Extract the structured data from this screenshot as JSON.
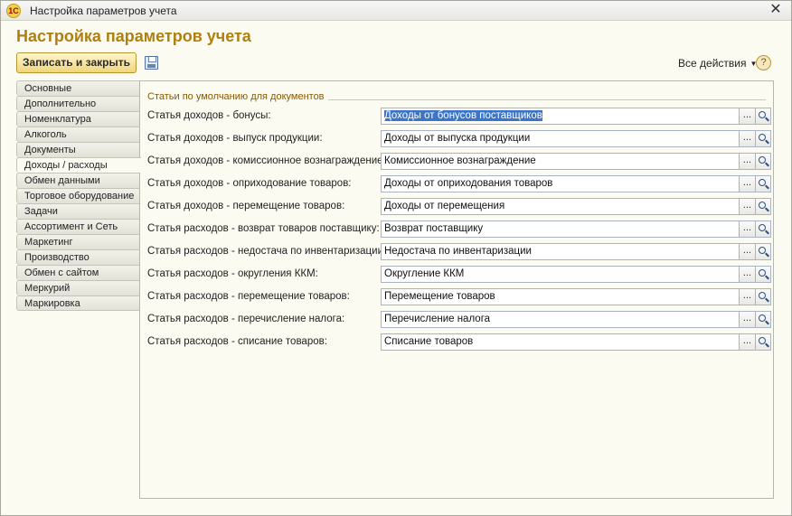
{
  "window": {
    "title": "Настройка параметров учета",
    "close_glyph": "✕",
    "app_icon_text": "1С"
  },
  "header": {
    "page_title": "Настройка параметров учета"
  },
  "toolbar": {
    "save_close_label": "Записать и закрыть",
    "all_actions_label": "Все действия",
    "help_glyph": "?"
  },
  "tabs": [
    {
      "label": "Основные",
      "active": false
    },
    {
      "label": "Дополнительно",
      "active": false
    },
    {
      "label": "Номенклатура",
      "active": false
    },
    {
      "label": "Алкоголь",
      "active": false
    },
    {
      "label": "Документы",
      "active": false
    },
    {
      "label": "Доходы / расходы",
      "active": true
    },
    {
      "label": "Обмен данными",
      "active": false
    },
    {
      "label": "Торговое оборудование",
      "active": false
    },
    {
      "label": "Задачи",
      "active": false
    },
    {
      "label": "Ассортимент и Сеть",
      "active": false
    },
    {
      "label": "Маркетинг",
      "active": false
    },
    {
      "label": "Производство",
      "active": false
    },
    {
      "label": "Обмен с сайтом",
      "active": false
    },
    {
      "label": "Меркурий",
      "active": false
    },
    {
      "label": "Маркировка",
      "active": false
    }
  ],
  "group": {
    "title": "Статьи по умолчанию для документов",
    "rows": [
      {
        "label": "Статья доходов - бонусы:",
        "value": "Доходы от бонусов поставщиков",
        "selected": true
      },
      {
        "label": "Статья доходов - выпуск продукции:",
        "value": "Доходы от выпуска продукции",
        "selected": false
      },
      {
        "label": "Статья доходов - комиссионное вознаграждение:",
        "value": "Комиссионное вознаграждение",
        "selected": false
      },
      {
        "label": "Статья доходов - оприходование товаров:",
        "value": "Доходы от оприходования товаров",
        "selected": false
      },
      {
        "label": "Статья доходов - перемещение товаров:",
        "value": "Доходы от перемещения",
        "selected": false
      },
      {
        "label": "Статья расходов - возврат товаров поставщику:",
        "value": "Возврат поставщику",
        "selected": false
      },
      {
        "label": "Статья расходов - недостача по инвентаризации:",
        "value": "Недостача по инвентаризации",
        "selected": false
      },
      {
        "label": "Статья расходов - округления ККМ:",
        "value": "Округление ККМ",
        "selected": false
      },
      {
        "label": "Статья расходов - перемещение товаров:",
        "value": "Перемещение товаров",
        "selected": false
      },
      {
        "label": "Статья расходов - перечисление налога:",
        "value": "Перечисление налога",
        "selected": false
      },
      {
        "label": "Статья расходов - списание товаров:",
        "value": "Списание товаров",
        "selected": false
      }
    ],
    "dots_glyph": "..."
  },
  "colors": {
    "title_accent": "#b07f12",
    "selection": "#3c74c7"
  }
}
